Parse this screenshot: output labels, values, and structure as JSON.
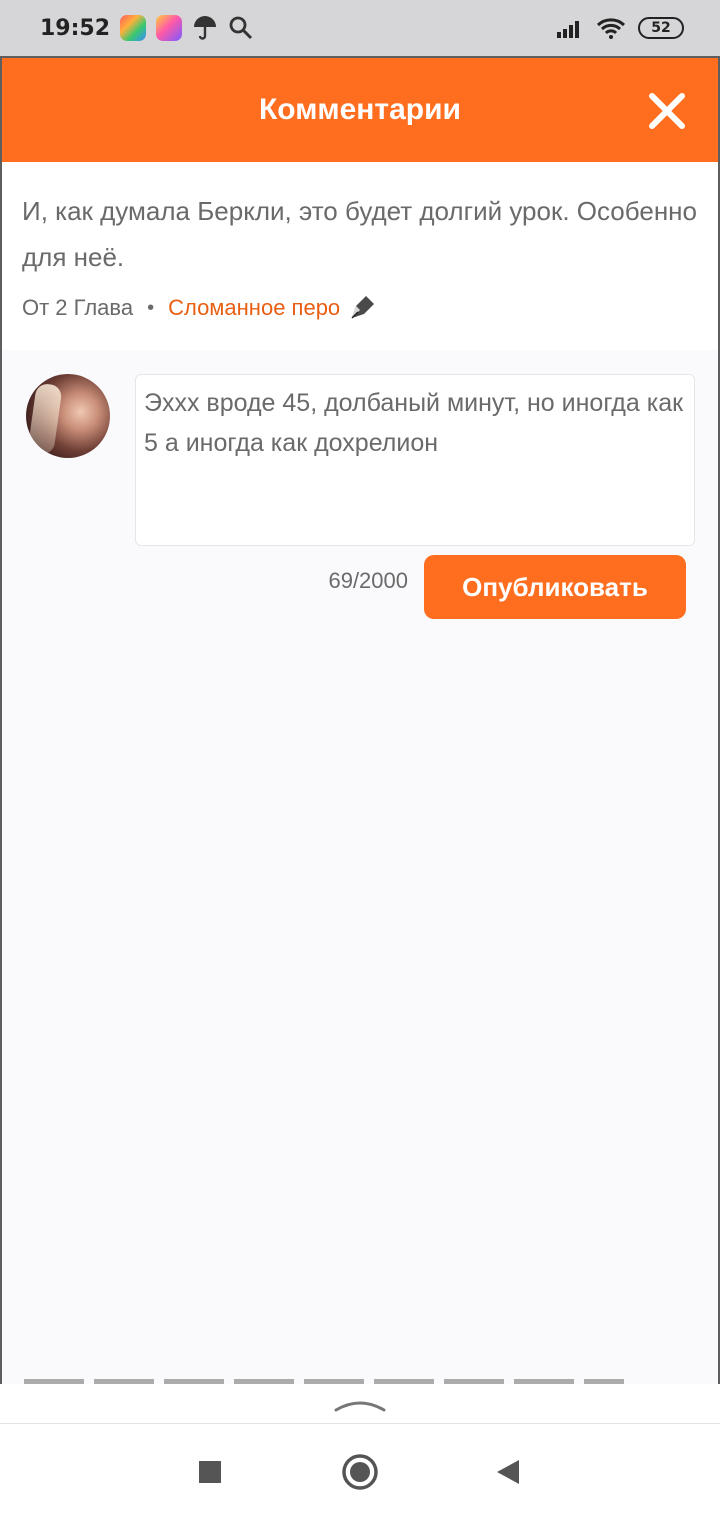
{
  "status_bar": {
    "time": "19:52",
    "battery": "52",
    "icons": [
      "app-icon-1",
      "app-icon-2",
      "umbrella-icon",
      "search-icon",
      "signal-icon",
      "wifi-icon",
      "battery-icon"
    ]
  },
  "header": {
    "title": "Комментарии",
    "close_icon": "close-icon"
  },
  "quote": {
    "text": "И, как думала Беркли, это будет долгий урок. Особенно для неё.",
    "chapter": "От 2 Глава",
    "separator": "•",
    "author": "Сломанное перо",
    "author_icon": "pen-icon"
  },
  "composer": {
    "value": "Эххх вроде 45, долбаный минут, но иногда как 5 а иногда как дохрелион",
    "char_count": "69/2000",
    "publish_label": "Опубликовать"
  },
  "colors": {
    "accent": "#ff6d1f",
    "author_link": "#e85f14",
    "background": "#faf9fc"
  },
  "nav": {
    "icons": [
      "recents-icon",
      "home-icon",
      "back-icon"
    ]
  }
}
